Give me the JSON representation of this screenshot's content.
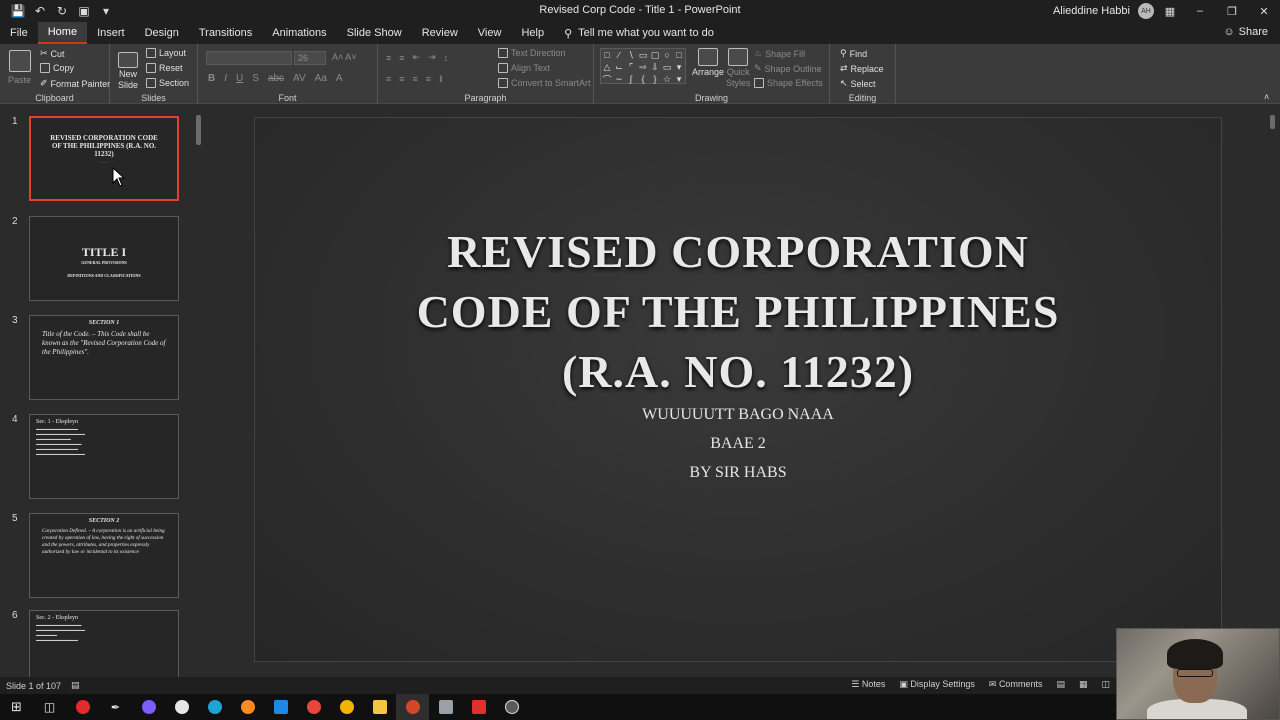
{
  "app": {
    "window_title": "Revised Corp Code - Title 1  -  PowerPoint",
    "user_name": "Alieddine Habbi",
    "user_initials": "AH"
  },
  "tabs": [
    "File",
    "Home",
    "Insert",
    "Design",
    "Transitions",
    "Animations",
    "Slide Show",
    "Review",
    "View",
    "Help"
  ],
  "active_tab": "Home",
  "tell_me": "Tell me what you want to do",
  "share": "Share",
  "ribbon": {
    "clipboard": {
      "label": "Clipboard",
      "paste": "Paste",
      "cut": "Cut",
      "copy": "Copy",
      "format_painter": "Format Painter"
    },
    "slides": {
      "label": "Slides",
      "new_slide": "New",
      "new_slide2": "Slide",
      "layout": "Layout",
      "reset": "Reset",
      "section": "Section"
    },
    "font": {
      "label": "Font",
      "size": "26"
    },
    "paragraph": {
      "label": "Paragraph",
      "text_direction": "Text Direction",
      "align_text": "Align Text",
      "convert": "Convert to SmartArt"
    },
    "drawing": {
      "label": "Drawing",
      "arrange": "Arrange",
      "quick_styles": "Quick",
      "quick_styles2": "Styles",
      "shape_fill": "Shape Fill",
      "shape_outline": "Shape Outline",
      "shape_effects": "Shape Effects"
    },
    "editing": {
      "label": "Editing",
      "find": "Find",
      "replace": "Replace",
      "select": "Select"
    }
  },
  "thumbnails": [
    {
      "num": "1",
      "title": "REVISED CORPORATION CODE OF THE PHILIPPINES (R.A. NO. 11232)"
    },
    {
      "num": "2",
      "title": "TITLE I",
      "sub1": "GENERAL PROVISIONS",
      "sub2": "DEFINITIONS AND CLASSIFICATIONS"
    },
    {
      "num": "3",
      "title": "SECTION 1",
      "body": "Title of the Code. – This Code shall be known as the \"Revised Corporation Code of the Philippines\"."
    },
    {
      "num": "4",
      "title": "Sec. 1 - Ekspleyn"
    },
    {
      "num": "5",
      "title": "SECTION 2",
      "body": "Corporation Defined. – A corporation is an artificial being created by operation of law, having the right of succession and the powers, attributes, and properties expressly authorized by law or incidental to its existence"
    },
    {
      "num": "6",
      "title": "Sec. 2 - Ekspleyn"
    }
  ],
  "slide": {
    "title_line1": "REVISED CORPORATION",
    "title_line2": "CODE OF THE PHILIPPINES",
    "title_line3": "(R.A. NO. 11232)",
    "line1": "WUUUUUTT BAGO NAAA",
    "line2": "BAAE 2",
    "line3": "BY SIR HABS"
  },
  "status": {
    "slide_of": "Slide 1 of 107",
    "notes": "Notes",
    "display_settings": "Display Settings",
    "comments": "Comments"
  }
}
